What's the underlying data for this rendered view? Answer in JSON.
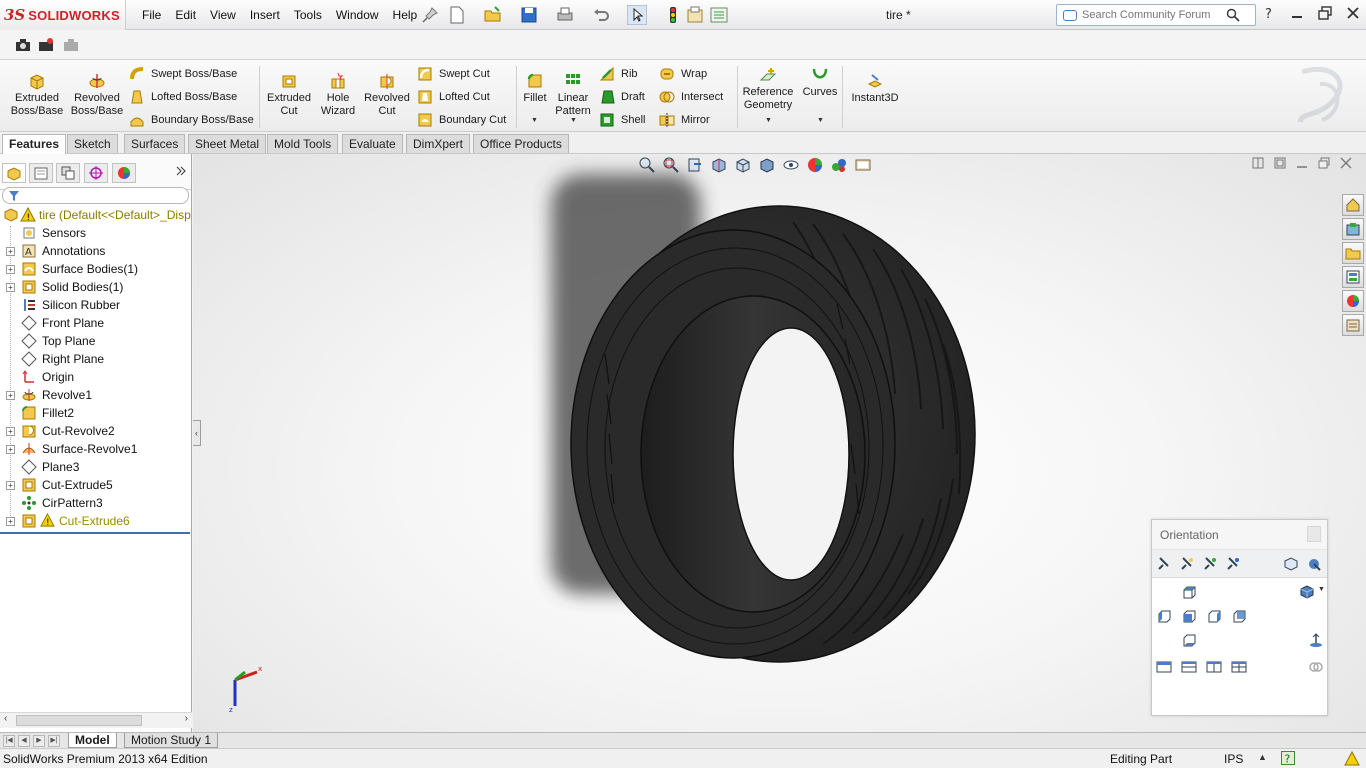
{
  "app": {
    "logo_prefix": "3S",
    "logo_text": "SOLIDWORKS",
    "document_title": "tire *"
  },
  "menu": [
    "File",
    "Edit",
    "View",
    "Insert",
    "Tools",
    "Window",
    "Help"
  ],
  "search": {
    "placeholder": "Search Community Forum"
  },
  "ribbon": {
    "extruded_boss": [
      "Extruded",
      "Boss/Base"
    ],
    "revolved_boss": [
      "Revolved",
      "Boss/Base"
    ],
    "swept_boss": "Swept Boss/Base",
    "lofted_boss": "Lofted Boss/Base",
    "boundary_boss": "Boundary Boss/Base",
    "extruded_cut": [
      "Extruded",
      "Cut"
    ],
    "hole_wizard": [
      "Hole",
      "Wizard"
    ],
    "revolved_cut": [
      "Revolved",
      "Cut"
    ],
    "swept_cut": "Swept Cut",
    "lofted_cut": "Lofted Cut",
    "boundary_cut": "Boundary Cut",
    "fillet": "Fillet",
    "linear_pattern": [
      "Linear",
      "Pattern"
    ],
    "rib": "Rib",
    "draft": "Draft",
    "shell": "Shell",
    "wrap": "Wrap",
    "intersect": "Intersect",
    "mirror": "Mirror",
    "reference_geometry": [
      "Reference",
      "Geometry"
    ],
    "curves": "Curves",
    "instant3d": "Instant3D"
  },
  "tabs": [
    "Features",
    "Sketch",
    "Surfaces",
    "Sheet Metal",
    "Mold Tools",
    "Evaluate",
    "DimXpert",
    "Office Products"
  ],
  "tree": {
    "root": "tire  (Default<<Default>_Disp",
    "items": [
      {
        "label": "Sensors",
        "icon": "sensor-icon",
        "expandable": false
      },
      {
        "label": "Annotations",
        "icon": "annotations-icon",
        "expandable": true
      },
      {
        "label": "Surface Bodies(1)",
        "icon": "surface-bodies-icon",
        "expandable": true
      },
      {
        "label": "Solid Bodies(1)",
        "icon": "solid-bodies-icon",
        "expandable": true
      },
      {
        "label": "Silicon Rubber",
        "icon": "material-icon",
        "expandable": false
      },
      {
        "label": "Front Plane",
        "icon": "plane-icon",
        "expandable": false
      },
      {
        "label": "Top Plane",
        "icon": "plane-icon",
        "expandable": false
      },
      {
        "label": "Right Plane",
        "icon": "plane-icon",
        "expandable": false
      },
      {
        "label": "Origin",
        "icon": "origin-icon",
        "expandable": false
      },
      {
        "label": "Revolve1",
        "icon": "revolve-icon",
        "expandable": true
      },
      {
        "label": "Fillet2",
        "icon": "fillet-icon",
        "expandable": false
      },
      {
        "label": "Cut-Revolve2",
        "icon": "cut-revolve-icon",
        "expandable": true
      },
      {
        "label": "Surface-Revolve1",
        "icon": "surface-revolve-icon",
        "expandable": true
      },
      {
        "label": "Plane3",
        "icon": "plane-icon",
        "expandable": false
      },
      {
        "label": "Cut-Extrude5",
        "icon": "cut-extrude-icon",
        "expandable": true
      },
      {
        "label": "CirPattern3",
        "icon": "circular-pattern-icon",
        "expandable": false
      },
      {
        "label": "Cut-Extrude6",
        "icon": "cut-extrude-icon",
        "expandable": true,
        "warning": true
      }
    ]
  },
  "orientation": {
    "title": "Orientation"
  },
  "bottom_tabs": [
    "Model",
    "Motion Study 1"
  ],
  "status": {
    "edition": "SolidWorks Premium 2013 x64 Edition",
    "mode": "Editing Part",
    "units": "IPS"
  },
  "colors": {
    "brand_red": "#d32026",
    "tire": "#2b2b2b",
    "warning": "#e8c000"
  }
}
